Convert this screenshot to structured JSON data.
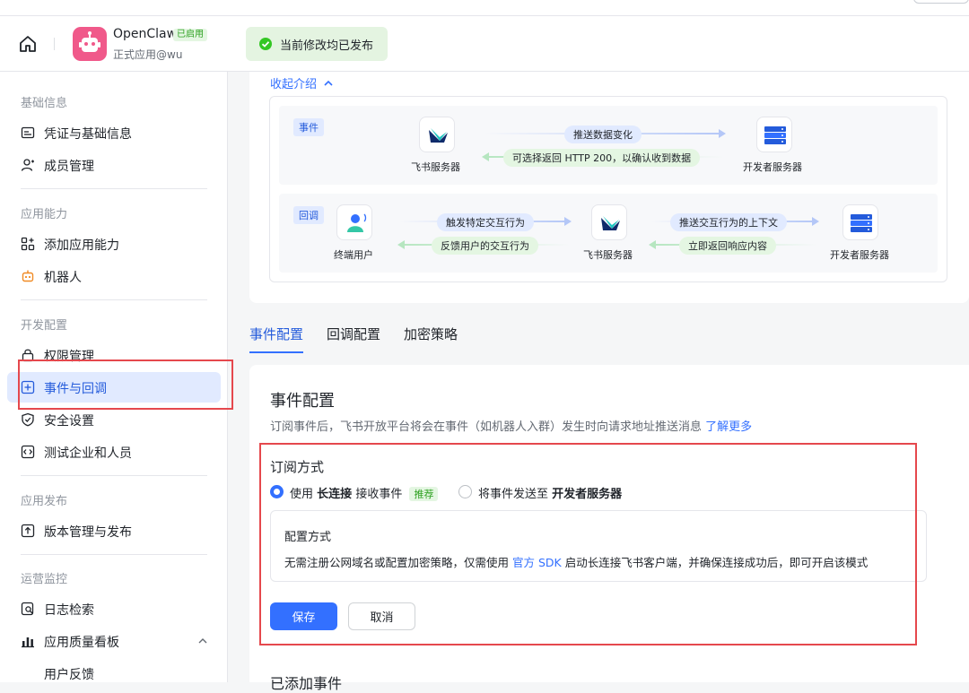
{
  "header": {
    "app_name": "OpenClaw",
    "app_badge": "已启用",
    "app_subtitle": "正式应用@wu",
    "toast": "当前修改均已发布"
  },
  "sidebar": {
    "sections": [
      {
        "title": "基础信息",
        "items": [
          {
            "label": "凭证与基础信息",
            "icon": "id-card-icon"
          },
          {
            "label": "成员管理",
            "icon": "user-add-icon"
          }
        ]
      },
      {
        "title": "应用能力",
        "items": [
          {
            "label": "添加应用能力",
            "icon": "grid-add-icon"
          },
          {
            "label": "机器人",
            "icon": "robot-icon"
          }
        ]
      },
      {
        "title": "开发配置",
        "items": [
          {
            "label": "权限管理",
            "icon": "lock-icon"
          },
          {
            "label": "事件与回调",
            "icon": "event-icon",
            "active": true
          },
          {
            "label": "安全设置",
            "icon": "shield-icon"
          },
          {
            "label": "测试企业和人员",
            "icon": "code-icon"
          }
        ]
      },
      {
        "title": "应用发布",
        "items": [
          {
            "label": "版本管理与发布",
            "icon": "upload-icon"
          }
        ]
      },
      {
        "title": "运营监控",
        "items": [
          {
            "label": "日志检索",
            "icon": "log-search-icon"
          },
          {
            "label": "应用质量看板",
            "icon": "chart-icon"
          },
          {
            "label": "用户反馈"
          }
        ]
      }
    ]
  },
  "intro": {
    "collapse_label": "收起介绍",
    "event_tag": "事件",
    "callback_tag": "回调",
    "event_row": {
      "left_node": "飞书服务器",
      "right_node": "开发者服务器",
      "push_label": "推送数据变化",
      "return_label": "可选择返回 HTTP 200，以确认收到数据"
    },
    "callback_row": {
      "user_node": "终端用户",
      "mid_node": "飞书服务器",
      "right_node": "开发者服务器",
      "trigger_label": "触发特定交互行为",
      "feedback_label": "反馈用户的交互行为",
      "push_ctx_label": "推送交互行为的上下文",
      "return_label": "立即返回响应内容"
    }
  },
  "tabs": [
    "事件配置",
    "回调配置",
    "加密策略"
  ],
  "panel": {
    "title": "事件配置",
    "desc": "订阅事件后，飞书开放平台将会在事件（如机器人入群）发生时向请求地址推送消息",
    "desc_link": "了解更多",
    "subscribe_label": "订阅方式",
    "option1_pre": "使用",
    "option1_bold": "长连接",
    "option1_post": "接收事件",
    "option1_badge": "推荐",
    "option2_pre": "将事件发送至",
    "option2_bold": "开发者服务器",
    "config_title": "配置方式",
    "config_desc_pre": "无需注册公网域名或配置加密策略，仅需使用",
    "config_desc_link": "官方 SDK",
    "config_desc_post": "启动长连接飞书客户端，并确保连接成功后，即可开启该模式",
    "save": "保存",
    "cancel": "取消",
    "added_events": "已添加事件"
  },
  "colors": {
    "accent": "#3370ff",
    "highlight_box": "#e5484d",
    "toast_bg": "#e4f4e1"
  }
}
